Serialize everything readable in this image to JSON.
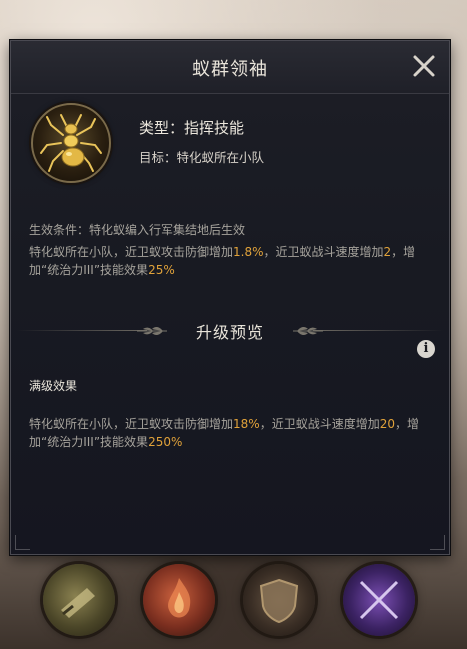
{
  "dialog": {
    "title": "蚁群领袖",
    "close_icon": "close-x-icon"
  },
  "skill": {
    "icon": "golden-ant-icon",
    "type_text": "类型：指挥技能",
    "target_text": "目标：特化蚁所在小队"
  },
  "effect": {
    "condition_text": "生效条件：特化蚁编入行军集结地后生效",
    "current": {
      "p1": "特化蚁所在小队，近卫蚁攻击防御增加",
      "v1": "1.8%",
      "p2": "，近卫蚁战斗速度增加",
      "v2": "2",
      "p3": "，增加“统治力III”技能效果",
      "v3": "25%"
    }
  },
  "upgrade": {
    "section_title": "升级预览",
    "info_icon": "info-icon",
    "max_label": "满级效果",
    "max": {
      "p1": "特化蚁所在小队，近卫蚁攻击防御增加",
      "v1": "18%",
      "p2": "，近卫蚁战斗速度增加",
      "v2": "20",
      "p3": "，增加“统治力III”技能效果",
      "v3": "250%"
    }
  },
  "colors": {
    "highlight": "#e0a23a",
    "body_text": "#a6a39c",
    "title_text": "#e9e4da",
    "panel_bg": "#1b1c24"
  },
  "bottom_tabs": [
    {
      "icon": "scroll-skill-icon"
    },
    {
      "icon": "fire-skill-icon"
    },
    {
      "icon": "shield-skill-icon"
    },
    {
      "icon": "crossed-swords-skill-icon"
    }
  ]
}
